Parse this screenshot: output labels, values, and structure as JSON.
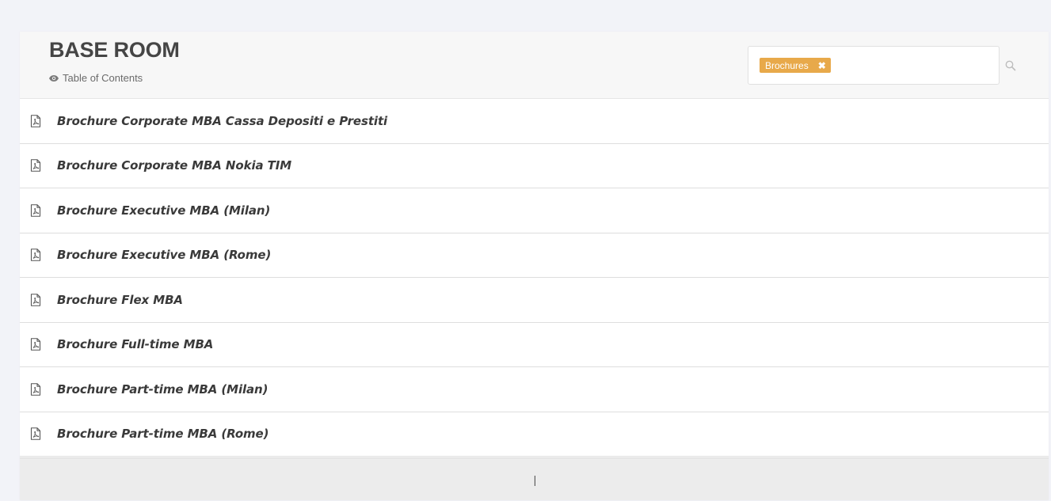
{
  "header": {
    "title": "BASE ROOM",
    "subtitle": "Table of Contents"
  },
  "search": {
    "tags": [
      {
        "label": "Brochures",
        "remove_glyph": "✖"
      }
    ],
    "placeholder": ""
  },
  "documents": [
    {
      "label": "Brochure Corporate MBA Cassa Depositi e Prestiti",
      "icon": "pdf-file-icon"
    },
    {
      "label": "Brochure Corporate MBA Nokia TIM",
      "icon": "pdf-file-icon"
    },
    {
      "label": "Brochure Executive MBA (Milan)",
      "icon": "pdf-file-icon"
    },
    {
      "label": "Brochure Executive MBA (Rome)",
      "icon": "pdf-file-icon"
    },
    {
      "label": "Brochure Flex MBA",
      "icon": "pdf-file-icon"
    },
    {
      "label": "Brochure Full-time MBA",
      "icon": "pdf-file-icon"
    },
    {
      "label": "Brochure Part-time MBA (Milan)",
      "icon": "pdf-file-icon"
    },
    {
      "label": "Brochure Part-time MBA (Rome)",
      "icon": "pdf-file-icon"
    }
  ],
  "footer": {
    "text": "|"
  },
  "colors": {
    "tag_background": "#e8a94a",
    "page_background": "#f2f3f8",
    "header_background": "#f7f7f7",
    "footer_background": "#ececec"
  }
}
